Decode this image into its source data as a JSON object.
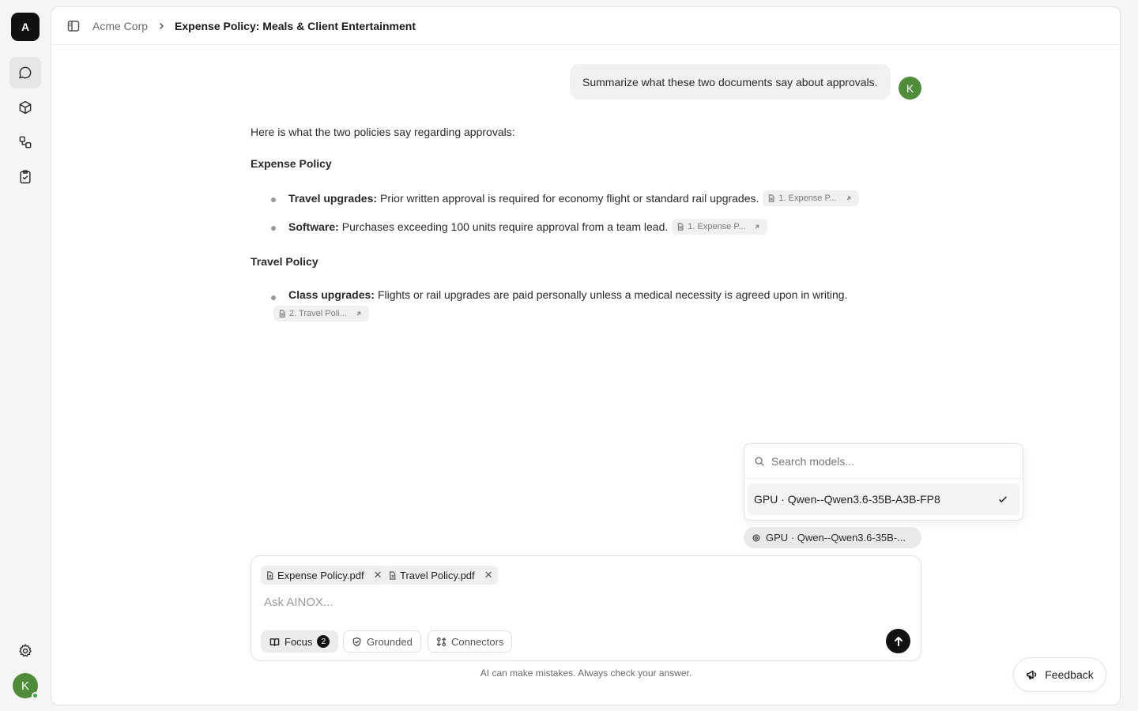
{
  "workspace": {
    "logo_letter": "A",
    "user_initial": "K"
  },
  "rail": {
    "items": [
      {
        "name": "chat",
        "icon": "chat-bubble-icon",
        "active": true
      },
      {
        "name": "models",
        "icon": "cube-icon",
        "active": false
      },
      {
        "name": "workflows",
        "icon": "workflow-icon",
        "active": false
      },
      {
        "name": "tasks",
        "icon": "clipboard-check-icon",
        "active": false
      }
    ],
    "settings_icon": "gear-icon"
  },
  "breadcrumb": {
    "root": "Acme Corp",
    "current": "Expense Policy: Meals & Client Entertainment"
  },
  "user_message": {
    "text": "Summarize what these two documents say about approvals.",
    "initial": "K"
  },
  "assistant": {
    "intro": "Here is what the two policies say regarding approvals:",
    "sections": [
      {
        "heading": "Expense Policy",
        "items": [
          {
            "label": "Travel upgrades:",
            "text": "Prior written approval is required for economy flight or standard rail upgrades.",
            "citation": "1. Expense P..."
          },
          {
            "label": "Software:",
            "text": "Purchases exceeding 100 units require approval from a team lead.",
            "citation": "1. Expense P..."
          }
        ]
      },
      {
        "heading": "Travel Policy",
        "items": [
          {
            "label": "Class upgrades:",
            "text": "Flights or rail upgrades are paid personally unless a medical necessity is agreed upon in writing.",
            "citation": "2. Travel Poli..."
          }
        ]
      }
    ]
  },
  "model_picker": {
    "search_placeholder": "Search models...",
    "options": [
      {
        "label": "GPU · Qwen--Qwen3.6-35B-A3B-FP8",
        "selected": true
      }
    ],
    "current_chip": "GPU · Qwen--Qwen3.6-35B-..."
  },
  "composer": {
    "attachments": [
      "Expense Policy.pdf",
      "Travel Policy.pdf"
    ],
    "placeholder": "Ask AINOX...",
    "tools": {
      "focus_label": "Focus",
      "focus_count": "2",
      "grounded_label": "Grounded",
      "connectors_label": "Connectors"
    }
  },
  "disclaimer": "AI can make mistakes. Always check your answer.",
  "feedback_label": "Feedback",
  "colors": {
    "accent_dark": "#111111",
    "avatar_green": "#4e8c3a",
    "online_green": "#3cb043"
  }
}
